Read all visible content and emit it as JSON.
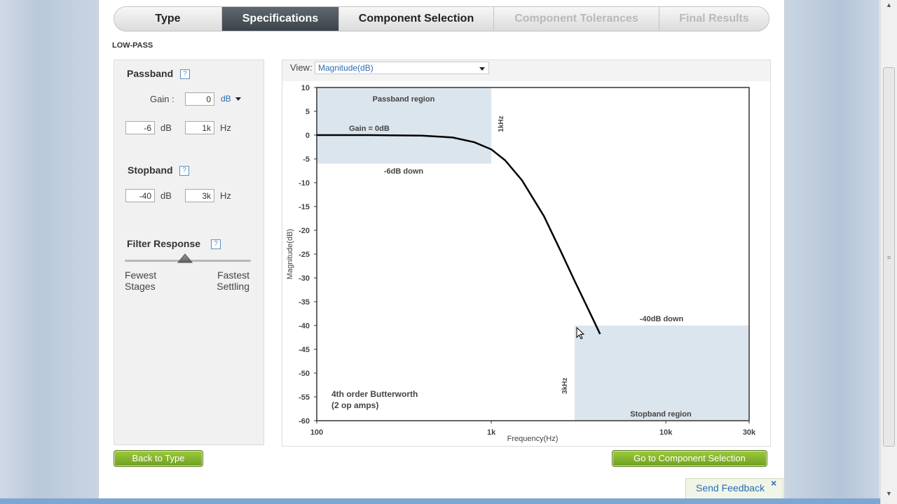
{
  "tabs": [
    {
      "label": "Type",
      "state": "normal"
    },
    {
      "label": "Specifications",
      "state": "active"
    },
    {
      "label": "Component Selection",
      "state": "normal"
    },
    {
      "label": "Component Tolerances",
      "state": "disabled"
    },
    {
      "label": "Final Results",
      "state": "disabled"
    }
  ],
  "filter_type_label": "LOW-PASS",
  "passband": {
    "title": "Passband",
    "help": "?",
    "gain_label": "Gain :",
    "gain_value": "0",
    "gain_unit": "dB",
    "atten_value": "-6",
    "atten_unit": "dB",
    "freq_value": "1k",
    "freq_unit": "Hz"
  },
  "stopband": {
    "title": "Stopband",
    "help": "?",
    "atten_value": "-40",
    "atten_unit": "dB",
    "freq_value": "3k",
    "freq_unit": "Hz"
  },
  "filter_response": {
    "title": "Filter Response",
    "help": "?",
    "left_label_1": "Fewest",
    "left_label_2": "Stages",
    "right_label_1": "Fastest",
    "right_label_2": "Settling",
    "slider_level": 0.48
  },
  "view": {
    "label": "View:",
    "selected": "Magnitude(dB)"
  },
  "chart_data": {
    "type": "line",
    "xlabel": "Frequency(Hz)",
    "ylabel": "Magnitude(dB)",
    "x_scale": "log",
    "xlim": [
      100,
      30000
    ],
    "ylim": [
      -60,
      10
    ],
    "x_ticks": [
      {
        "value": 100,
        "label": "100"
      },
      {
        "value": 1000,
        "label": "1k"
      },
      {
        "value": 10000,
        "label": "10k"
      },
      {
        "value": 30000,
        "label": "30k"
      }
    ],
    "y_ticks": [
      10,
      5,
      0,
      -5,
      -10,
      -15,
      -20,
      -25,
      -30,
      -35,
      -40,
      -45,
      -50,
      -55,
      -60
    ],
    "series": [
      {
        "x": [
          100,
          200,
          400,
          600,
          800,
          1000,
          1200,
          1500,
          2000,
          2500,
          3000,
          3500,
          4200
        ],
        "y": [
          0.0,
          0.0,
          -0.1,
          -0.5,
          -1.5,
          -3.0,
          -5.3,
          -9.5,
          -17.0,
          -24.4,
          -30.6,
          -35.7,
          -41.8
        ]
      }
    ],
    "regions": [
      {
        "name": "passband",
        "x": [
          100,
          1000
        ],
        "y": [
          -6,
          10
        ],
        "label": "Passband region",
        "color": "#dbe5ee"
      },
      {
        "name": "stopband",
        "x": [
          3000,
          30000
        ],
        "y": [
          -60,
          -40
        ],
        "label": "Stopband region",
        "color": "#dbe5ee"
      }
    ],
    "annotations": {
      "gain": "Gain = 0dB",
      "pass_down": "-6dB down",
      "stop_down": "-40dB down",
      "pass_freq": "1kHz",
      "stop_freq": "3kHz",
      "order_line1": "4th order Butterworth",
      "order_line2": "(2 op amps)"
    },
    "grid": false
  },
  "buttons": {
    "back": "Back to Type",
    "next": "Go to Component Selection"
  },
  "feedback": {
    "label": "Send Feedback",
    "close": "×"
  },
  "scrollbar": {
    "up": "▲",
    "down": "▼",
    "grip": "≡"
  }
}
